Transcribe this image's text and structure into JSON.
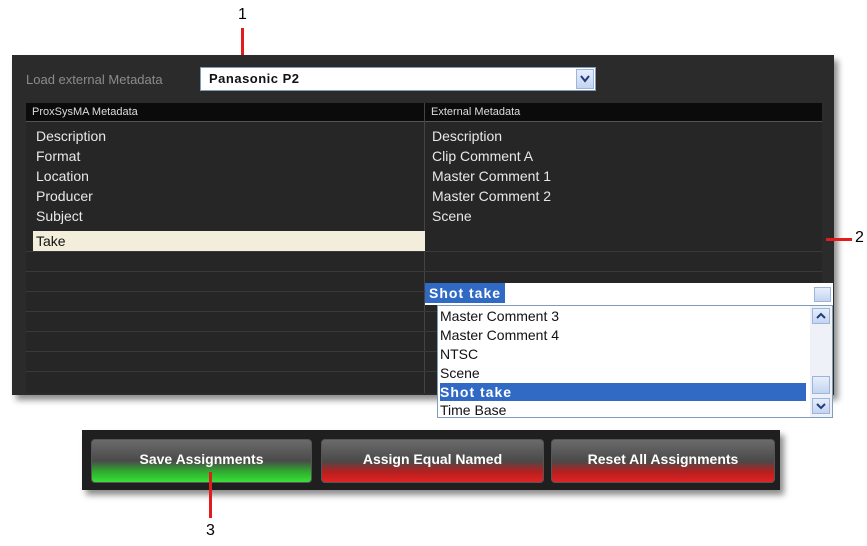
{
  "callouts": {
    "one": "1",
    "two": "2",
    "three": "3"
  },
  "load": {
    "label": "Load external Metadata",
    "value": "Panasonic P2"
  },
  "grid": {
    "headers": [
      "ProxSysMA Metadata",
      "External Metadata"
    ],
    "rows": [
      {
        "left": "Description",
        "right": "Description"
      },
      {
        "left": "Format",
        "right": "Clip Comment A"
      },
      {
        "left": "Location",
        "right": "Master Comment 1"
      },
      {
        "left": "Producer",
        "right": "Master Comment 2"
      },
      {
        "left": "Subject",
        "right": "Scene"
      },
      {
        "left": "Take",
        "right": "Shot take"
      }
    ]
  },
  "dropdown": {
    "options": [
      "Master Comment 3",
      "Master Comment 4",
      "NTSC",
      "Scene",
      "Shot take",
      "Time Base"
    ],
    "selected": "Shot take"
  },
  "buttons": {
    "save": "Save Assignments",
    "assign_equal": "Assign Equal Named",
    "reset": "Reset All Assignments"
  },
  "icons": [
    "chevron-down-icon",
    "scroll-up-icon",
    "scroll-down-icon"
  ],
  "colors": {
    "accent_blue": "#316ac5",
    "callout_red": "#e21c1c",
    "save_green": "#38e038",
    "reset_red": "#e02222"
  }
}
